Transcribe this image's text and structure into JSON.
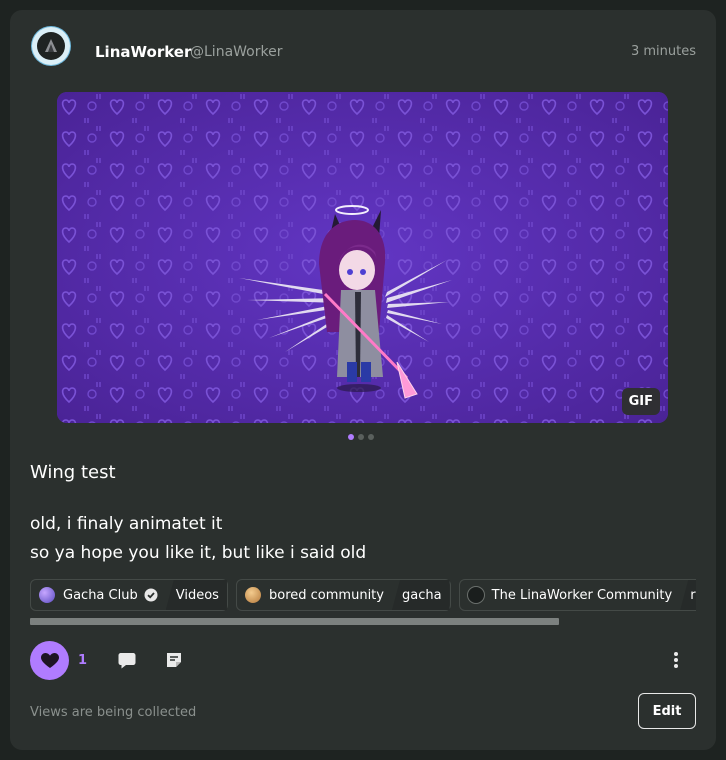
{
  "post": {
    "author_name": "LinaWorker",
    "author_handle": "@LinaWorker",
    "timestamp": "3 minutes",
    "media_badge": "GIF",
    "title": "Wing test",
    "body_lines": [
      "old, i finaly animatet it",
      "so ya hope you like it, but like i said old"
    ]
  },
  "tags": [
    {
      "community": "Gacha Club",
      "category": "Videos",
      "verified": true,
      "icon_color": "#8f7bd6"
    },
    {
      "community": "bored community",
      "category": "gacha",
      "verified": false,
      "icon_color": "#d9a46a"
    },
    {
      "community": "The LinaWorker Community",
      "category": "ra",
      "verified": false,
      "icon_color": "#1d2221"
    }
  ],
  "actions": {
    "like_count": "1",
    "views_text": "Views are being collected",
    "edit_label": "Edit"
  },
  "colors": {
    "accent": "#b07cff",
    "card_bg": "#2b302e",
    "page_bg": "#1e2321",
    "media_bg": "#5a2fb1"
  },
  "icons": [
    "avatar-icon",
    "verified-icon",
    "heart-icon",
    "comment-icon",
    "share-icon",
    "more-icon"
  ]
}
